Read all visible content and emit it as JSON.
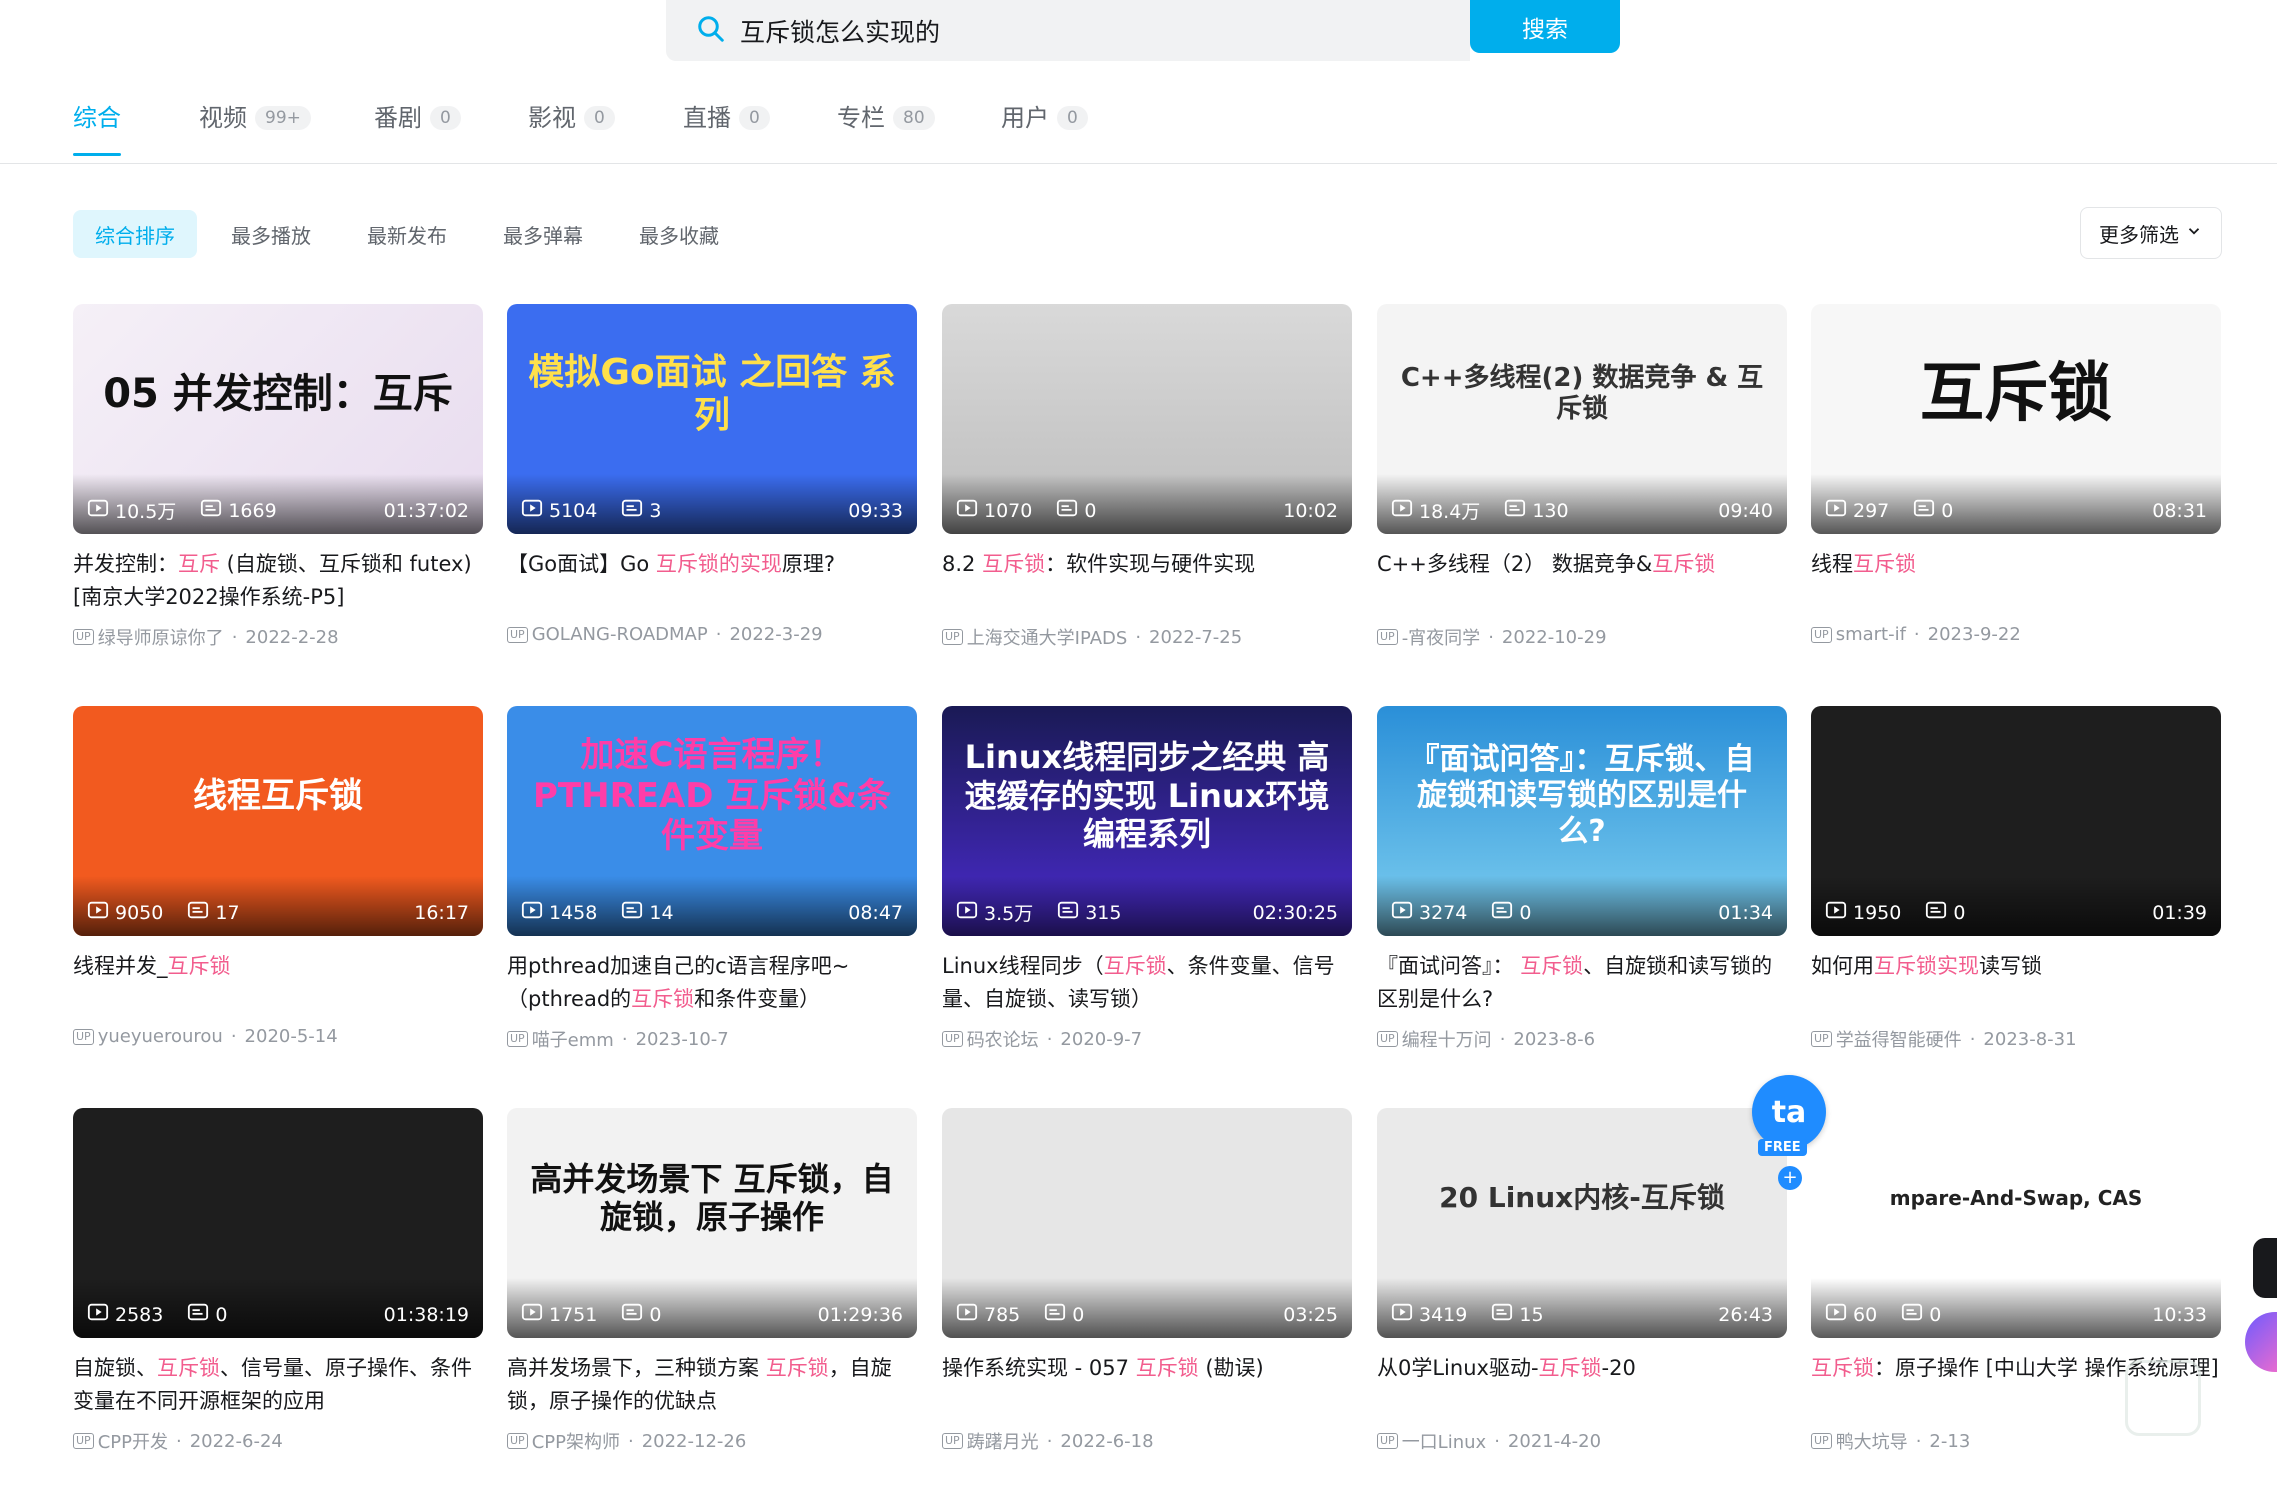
{
  "search": {
    "query": "互斥锁怎么实现的",
    "button": "搜索"
  },
  "tabs": [
    {
      "label": "综合",
      "count": ""
    },
    {
      "label": "视频",
      "count": "99+"
    },
    {
      "label": "番剧",
      "count": "0"
    },
    {
      "label": "影视",
      "count": "0"
    },
    {
      "label": "直播",
      "count": "0"
    },
    {
      "label": "专栏",
      "count": "80"
    },
    {
      "label": "用户",
      "count": "0"
    }
  ],
  "filters": [
    "综合排序",
    "最多播放",
    "最新发布",
    "最多弹幕",
    "最多收藏"
  ],
  "more_filter": "更多筛选",
  "up_badge": "UP",
  "videos": [
    {
      "thumb_text": "05 并发控制：互斥",
      "plays": "10.5万",
      "danmaku": "1669",
      "duration": "01:37:02",
      "title_pre": "并发控制：",
      "title_hl": "互斥",
      "title_post": " (自旋锁、互斥锁和 futex) [南京大学2022操作系统-P5]",
      "author": "绿导师原谅你了",
      "date": "2022-2-28"
    },
    {
      "thumb_text": "模拟Go面试 之回答 系列",
      "plays": "5104",
      "danmaku": "3",
      "duration": "09:33",
      "title_pre": "【Go面试】Go ",
      "title_hl": "互斥锁的实现",
      "title_post": "原理?",
      "author": "GOLANG-ROADMAP",
      "date": "2022-3-29"
    },
    {
      "thumb_text": "",
      "plays": "1070",
      "danmaku": "0",
      "duration": "10:02",
      "title_pre": "8.2 ",
      "title_hl": "互斥锁",
      "title_post": "：软件实现与硬件实现",
      "author": "上海交通大学IPADS",
      "date": "2022-7-25"
    },
    {
      "thumb_text": "C++多线程(2) 数据竞争 & 互斥锁",
      "plays": "18.4万",
      "danmaku": "130",
      "duration": "09:40",
      "title_pre": "C++多线程（2） 数据竞争&",
      "title_hl": "互斥锁",
      "title_post": "",
      "author": "-宵夜同学",
      "date": "2022-10-29"
    },
    {
      "thumb_text": "互斥锁",
      "plays": "297",
      "danmaku": "0",
      "duration": "08:31",
      "title_pre": "线程",
      "title_hl": "互斥锁",
      "title_post": "",
      "author": "smart-if",
      "date": "2023-9-22"
    },
    {
      "thumb_text": "线程互斥锁",
      "plays": "9050",
      "danmaku": "17",
      "duration": "16:17",
      "title_pre": "线程并发_",
      "title_hl": "互斥锁",
      "title_post": "",
      "author": "yueyuerourou",
      "date": "2020-5-14"
    },
    {
      "thumb_text": "加速C语言程序！ PTHREAD 互斥锁&条件变量",
      "plays": "1458",
      "danmaku": "14",
      "duration": "08:47",
      "title_pre": "用pthread加速自己的c语言程序吧~（pthread的",
      "title_hl": "互斥锁",
      "title_post": "和条件变量）",
      "author": "喵子emm",
      "date": "2023-10-7"
    },
    {
      "thumb_text": "Linux线程同步之经典 高速缓存的实现 Linux环境编程系列",
      "plays": "3.5万",
      "danmaku": "315",
      "duration": "02:30:25",
      "title_pre": "Linux线程同步（",
      "title_hl": "互斥锁",
      "title_post": "、条件变量、信号量、自旋锁、读写锁）",
      "author": "码农论坛",
      "date": "2020-9-7"
    },
    {
      "thumb_text": "『面试问答』：互斥锁、自旋锁和读写锁的区别是什么?",
      "plays": "3274",
      "danmaku": "0",
      "duration": "01:34",
      "title_pre": "『面试问答』： ",
      "title_hl": "互斥锁",
      "title_post": "、自旋锁和读写锁的区别是什么?",
      "author": "编程十万问",
      "date": "2023-8-6"
    },
    {
      "thumb_text": "",
      "plays": "1950",
      "danmaku": "0",
      "duration": "01:39",
      "title_pre": "如何用",
      "title_hl": "互斥锁实现",
      "title_post": "读写锁",
      "author": "学益得智能硬件",
      "date": "2023-8-31"
    },
    {
      "thumb_text": "",
      "plays": "2583",
      "danmaku": "0",
      "duration": "01:38:19",
      "title_pre": "自旋锁、",
      "title_hl": "互斥锁",
      "title_post": "、信号量、原子操作、条件变量在不同开源框架的应用",
      "author": "CPP开发",
      "date": "2022-6-24"
    },
    {
      "thumb_text": "高并发场景下 互斥锁，自旋锁，原子操作",
      "plays": "1751",
      "danmaku": "0",
      "duration": "01:29:36",
      "title_pre": "高并发场景下，三种锁方案 ",
      "title_hl": "互斥锁",
      "title_post": "，自旋锁，原子操作的优缺点",
      "author": "CPP架构师",
      "date": "2022-12-26"
    },
    {
      "thumb_text": "",
      "plays": "785",
      "danmaku": "0",
      "duration": "03:25",
      "title_pre": "操作系统实现 - 057 ",
      "title_hl": "互斥锁",
      "title_post": " (勘误)",
      "author": "踌躇月光",
      "date": "2022-6-18"
    },
    {
      "thumb_text": "20 Linux内核-互斥锁",
      "plays": "3419",
      "danmaku": "15",
      "duration": "26:43",
      "title_pre": "从0学Linux驱动-",
      "title_hl": "互斥锁",
      "title_post": "-20",
      "author": "一口Linux",
      "date": "2021-4-20"
    },
    {
      "thumb_text": "mpare-And-Swap, CAS",
      "plays": "60",
      "danmaku": "0",
      "duration": "10:33",
      "title_pre": "",
      "title_hl": "互斥锁",
      "title_post": "：原子操作 [中山大学 操作系统原理]",
      "author": "鸭大坑导",
      "date": "2-13"
    }
  ],
  "overlay_badge": {
    "label": "FREE",
    "glyph": "ta"
  }
}
